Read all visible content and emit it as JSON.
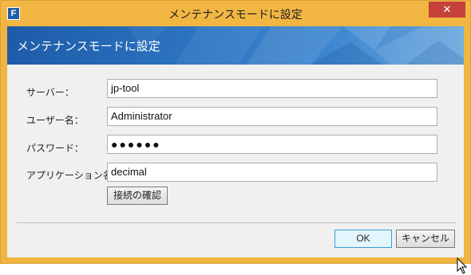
{
  "window": {
    "title": "メンテナンスモードに設定",
    "app_icon": "F",
    "close_glyph": "✕"
  },
  "banner": {
    "title": "メンテナンスモードに設定"
  },
  "form": {
    "server_label": "サーバー：",
    "server_value": "jp-tool",
    "username_label": "ユーザー名：",
    "username_value": "Administrator",
    "password_label": "パスワード：",
    "password_masked": "●●●●●●",
    "appname_label": "アプリケーション名：",
    "appname_value": "decimal",
    "check_connection_label": "接続の確認"
  },
  "footer": {
    "ok_label": "OK",
    "cancel_label": "キャンセル"
  },
  "colors": {
    "title_bar": "#f2b643",
    "close_button": "#c7413b",
    "banner": "#2c73c0",
    "ok_border": "#3c9bd6"
  }
}
